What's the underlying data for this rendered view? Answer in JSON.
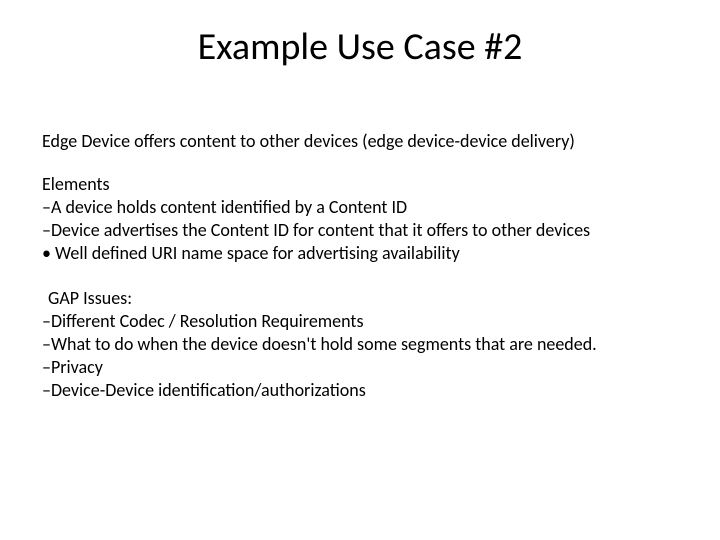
{
  "title": "Example Use Case #2",
  "subtitle": "Edge Device offers content to other devices  (edge device-device delivery)",
  "elements": {
    "heading": "Elements",
    "items": [
      "A device holds content identified by a Content ID",
      "Device advertises the Content ID for content that it offers to other devices"
    ],
    "bullet": "Well defined URI name space for advertising availability"
  },
  "gap": {
    "heading": "GAP Issues:",
    "items": [
      "Different Codec / Resolution Requirements",
      "What to do when the device doesn't hold some segments that are needed.",
      "Privacy",
      "Device-Device identification/authorizations"
    ]
  }
}
